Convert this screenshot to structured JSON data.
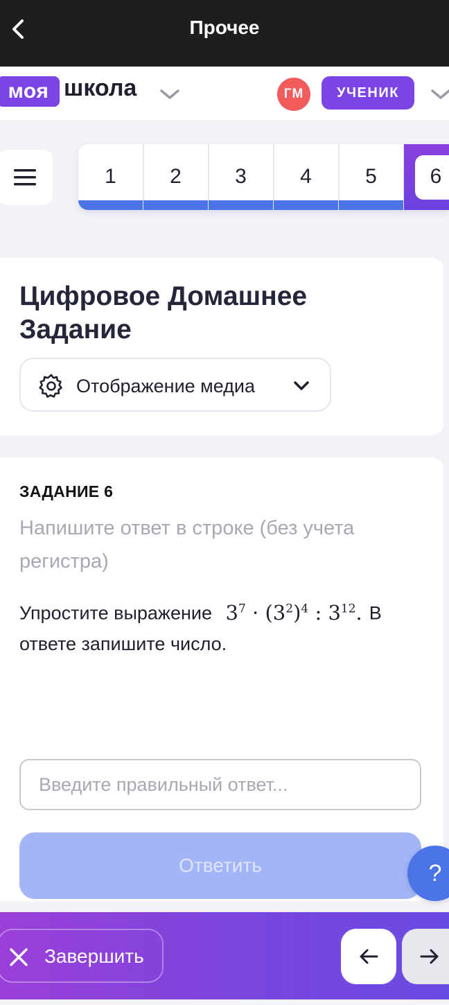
{
  "topbar": {
    "title": "Прочее"
  },
  "header": {
    "logo_badge": "моя",
    "logo_text": "школа",
    "avatar_initials": "ГМ",
    "role": "УЧЕНИК"
  },
  "task_nav": {
    "items": [
      {
        "label": "1",
        "status": "answered"
      },
      {
        "label": "2",
        "status": "answered"
      },
      {
        "label": "3",
        "status": "answered"
      },
      {
        "label": "4",
        "status": "answered"
      },
      {
        "label": "5",
        "status": "answered"
      },
      {
        "label": "6",
        "status": "current"
      }
    ]
  },
  "assignment": {
    "title": "Цифровое Домашнее Задание",
    "media_button_label": "Отображение медиа"
  },
  "task": {
    "label": "ЗАДАНИЕ 6",
    "hint": "Напишите ответ в строке (без учета регистра)",
    "question_prefix": "Упростите выражение",
    "expression": {
      "b1": "3",
      "e1": "7",
      "dot": "·",
      "lp": "(",
      "b2": "3",
      "e2": "2",
      "rp": ")",
      "e3": "4",
      "colon": ":",
      "b3": "3",
      "e4": "12",
      "end": "."
    },
    "question_suffix": "В ответе запишите число.",
    "answer_placeholder": "Введите правильный ответ...",
    "submit_label": "Ответить"
  },
  "help": {
    "label": "?"
  },
  "footer": {
    "finish_label": "Завершить"
  },
  "colors": {
    "accent_purple": "#7c43e6",
    "progress_blue": "#4b74e8",
    "avatar_red": "#f25b5b",
    "topbar_dark": "#1e1e1f"
  }
}
